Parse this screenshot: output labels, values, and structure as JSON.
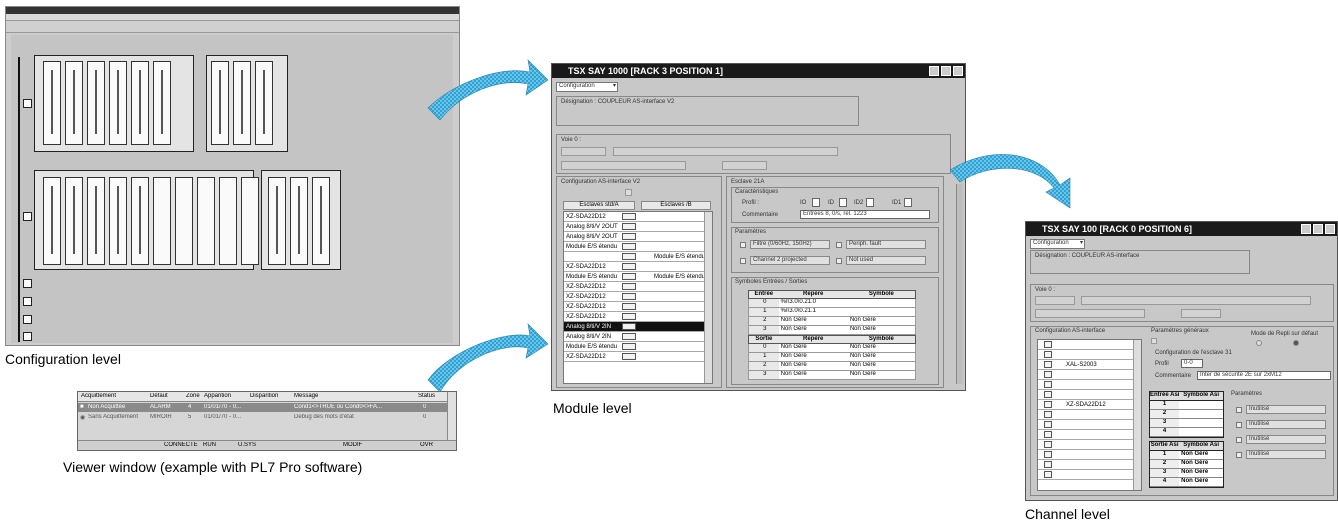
{
  "captions": {
    "configuration": "Configuration level",
    "viewer": "Viewer window (example with PL7 Pro software)",
    "module": "Module level",
    "channel": "Channel level"
  },
  "viewer": {
    "headers": [
      "Acquittement",
      "Défaut",
      "Zone",
      "Apparition",
      "Disparition",
      "Message",
      "Status"
    ],
    "rows": [
      [
        "Non Acquittée",
        "ALARM",
        "4",
        "01/01/70 - 0...",
        "",
        "Cond1<>TRUE ou Cond0<>FA...",
        "0"
      ],
      [
        "Sans Acquittement",
        "MIROIR",
        "5",
        "01/01/70 - 0...",
        "",
        "Debug des mots d'état",
        "0"
      ]
    ],
    "status": [
      "CONNECTE",
      "RUN",
      "U.SYS",
      "MODIF",
      "OVR"
    ]
  },
  "module_window": {
    "title": "TSX SAY 1000 [RACK 3    POSITION 1]",
    "view_select": "Configuration",
    "designation": "Désignation : COUPLEUR AS-interface V2",
    "voie_label": "Voie 0 :",
    "config_group": "Configuration AS-interface V2",
    "col_a": "Esclaves std/A",
    "col_b": "Esclaves /B",
    "slaves": [
      "XZ-SDA22D12",
      "Analog 8/ti/V 2OUT",
      "Analog 8/ti/V 2OUT",
      "Module E/S étendu",
      "",
      "XZ-SDA22D12",
      "Module E/S étendu",
      "XZ-SDA22D12",
      "XZ-SDA22D12",
      "XZ-SDA22D12",
      "XZ-SDA22D12",
      "Analog 8/ti/V 2IN",
      "Analog 8/ti/V 2IN",
      "Module E/S étendu",
      "XZ-SDA22D12"
    ],
    "b_labels": [
      "Module E/S étendu",
      "Module E/S étendu"
    ],
    "slave_title": "Esclave 21A",
    "caracteristiques": "Caractéristiques",
    "profil": "Profil :",
    "id_labels": [
      "IO",
      "ID",
      "ID2",
      "ID1"
    ],
    "commentaire": "Commentaire",
    "commentaire_val": "Entrées 8, 0/s, rel. 1223",
    "parametres": "Paramètres",
    "params": [
      "Filtre (0/60Hz, 150Hz)",
      "Periph. fault",
      "Channel 2 projected",
      "Not used"
    ],
    "symboles": "Symboles Entrées / Sorties",
    "io_headers": [
      "Entrée",
      "Repère",
      "Symbole"
    ],
    "io_rows": [
      [
        "0",
        "%I\\3.0\\0.21.0",
        ""
      ],
      [
        "1",
        "%I\\3.0\\0.21.1",
        ""
      ],
      [
        "2",
        "Non Géré",
        "Non Géré"
      ],
      [
        "3",
        "Non Géré",
        "Non Géré"
      ]
    ],
    "out_headers": [
      "Sortie",
      "Repère",
      "Symbole"
    ],
    "out_rows": [
      [
        "0",
        "Non Géré",
        "Non Géré"
      ],
      [
        "1",
        "Non Géré",
        "Non Géré"
      ],
      [
        "2",
        "Non Géré",
        "Non Géré"
      ],
      [
        "3",
        "Non Géré",
        "Non Géré"
      ]
    ]
  },
  "channel_window": {
    "title": "TSX SAY 100 [RACK 0    POSITION 6]",
    "view_select": "Configuration",
    "designation": "Désignation : COUPLEUR AS-interface",
    "voie_label": "Voie 0 :",
    "config_group": "Configuration AS-interface",
    "params_gen": "Paramètres généraux",
    "mode_repli": "Mode de Repli sur défaut",
    "slave_cfg": "Configuration de l'esclave 31",
    "profil": "Profil",
    "profil_val": "0-0",
    "commentaire": "Commentaire",
    "commentaire_val": "Inter de sécurité 2E sur 2xM12",
    "slaves": [
      "XAL-S2003",
      "XZ-SDA22D12"
    ],
    "in_headers": [
      "Entrée Asi",
      "Symbole Asi"
    ],
    "in_rows": [
      "1",
      "2",
      "3",
      "4"
    ],
    "out_headers": [
      "Sortie Asi",
      "Symbole Asi"
    ],
    "out_rows": [
      [
        "1",
        "Non Géré"
      ],
      [
        "2",
        "Non Géré"
      ],
      [
        "3",
        "Non Géré"
      ],
      [
        "4",
        "Non Géré"
      ]
    ],
    "parametres": "Paramètres",
    "params": [
      "Inutilisé",
      "Inutilisé",
      "Inutilisé",
      "Inutilisé"
    ]
  }
}
